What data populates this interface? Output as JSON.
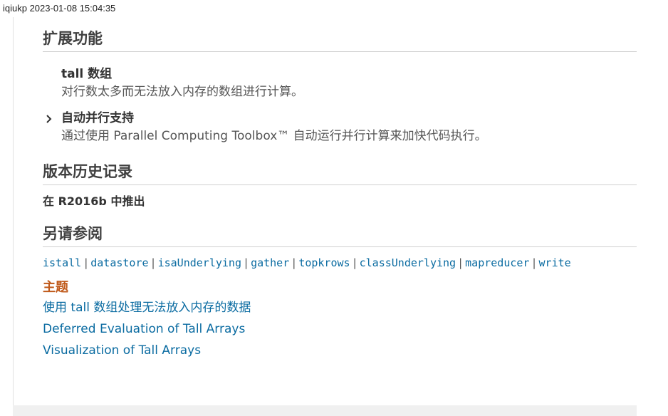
{
  "header": {
    "timestamp_label": "iqiukp 2023-01-08 15:04:35"
  },
  "extended": {
    "title": "扩展功能",
    "items": [
      {
        "title": "tall 数组",
        "desc": "对行数太多而无法放入内存的数组进行计算。"
      },
      {
        "title": "自动并行支持",
        "desc": "通过使用 Parallel Computing Toolbox™ 自动运行并行计算来加快代码执行。"
      }
    ]
  },
  "history": {
    "title": "版本历史记录",
    "line": "在 R2016b 中推出"
  },
  "see_also": {
    "title": "另请参阅",
    "links": [
      "istall",
      "datastore",
      "isaUnderlying",
      "gather",
      "topkrows",
      "classUnderlying",
      "mapreducer",
      "write"
    ],
    "separator": "|"
  },
  "topics": {
    "title": "主题",
    "links": [
      "使用 tall 数组处理无法放入内存的数据",
      "Deferred Evaluation of Tall Arrays",
      "Visualization of Tall Arrays"
    ]
  },
  "colors": {
    "link": "#0a6ba1",
    "topics_heading": "#c05a1b",
    "rule": "#cfcfcf"
  }
}
